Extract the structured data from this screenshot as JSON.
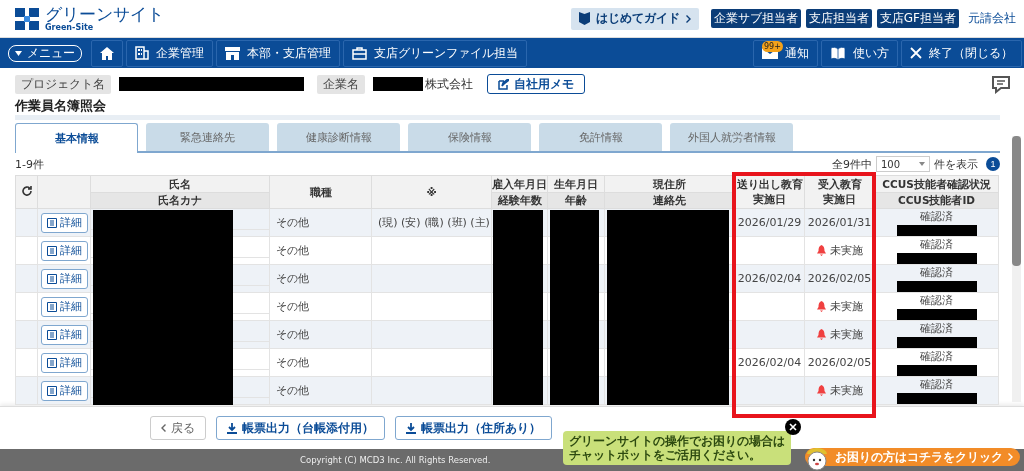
{
  "header": {
    "logo_title": "グリーンサイト",
    "logo_subtitle": "Green-Site",
    "guide_button": "はじめてガイド",
    "roles": [
      "企業サブ担当者",
      "支店担当者",
      "支店GF担当者"
    ],
    "company_type": "元請会社"
  },
  "nav": {
    "menu": "メニュー",
    "items": [
      {
        "label": "企業管理"
      },
      {
        "label": "本部・支店管理"
      },
      {
        "label": "支店グリーンファイル担当"
      }
    ],
    "right": [
      {
        "badge": "99+",
        "label": "通知"
      },
      {
        "label": "使い方"
      },
      {
        "label": "終了（閉じる）"
      }
    ]
  },
  "project": {
    "project_label": "プロジェクト名",
    "company_label": "企業名",
    "company_suffix": "株式会社",
    "memo_button": "自社用メモ"
  },
  "title": "作業員名簿照会",
  "tabs": [
    {
      "label": "基本情報",
      "selected": true
    },
    {
      "label": "緊急連絡先",
      "selected": false
    },
    {
      "label": "健康診断情報",
      "selected": false
    },
    {
      "label": "保険情報",
      "selected": false
    },
    {
      "label": "免許情報",
      "selected": false
    },
    {
      "label": "外国人就労者情報",
      "selected": false
    }
  ],
  "list_info": {
    "range": "1-9件",
    "total": "全9件中",
    "page_size": "100",
    "page_size_suffix": "件を表示",
    "page": "1"
  },
  "table": {
    "columns": [
      {
        "lines": [
          "氏名",
          "氏名カナ"
        ],
        "divided": true
      },
      {
        "lines": [
          "職種"
        ]
      },
      {
        "lines": [
          "※"
        ]
      },
      {
        "lines": [
          "雇入年月日",
          "経験年数"
        ],
        "divided": true
      },
      {
        "lines": [
          "生年月日",
          "年齢"
        ],
        "divided": true
      },
      {
        "lines": [
          "現住所",
          "連絡先"
        ],
        "divided": true
      },
      {
        "lines": [
          "送り出し教育",
          "実施日"
        ],
        "divided": false
      },
      {
        "lines": [
          "受入教育",
          "実施日"
        ],
        "divided": false
      },
      {
        "lines": [
          "CCUS技能者確認状況",
          "CCUS技能者ID"
        ],
        "divided": true
      }
    ],
    "rows": [
      {
        "detail": "詳細",
        "job": "その他",
        "marks": "(現) (安) (職) (班) (主)",
        "sent_date": "2026/01/29",
        "received": {
          "kind": "date",
          "text": "2026/01/31"
        },
        "ccus_status": "確認済"
      },
      {
        "detail": "詳細",
        "job": "その他",
        "received": {
          "kind": "pending",
          "text": "未実施"
        },
        "ccus_status": "確認済"
      },
      {
        "detail": "詳細",
        "job": "その他",
        "sent_date": "2026/02/04",
        "received": {
          "kind": "date",
          "text": "2026/02/05"
        },
        "ccus_status": "確認済"
      },
      {
        "detail": "詳細",
        "job": "その他",
        "received": {
          "kind": "pending",
          "text": "未実施"
        },
        "ccus_status": "確認済"
      },
      {
        "detail": "詳細",
        "job": "その他",
        "received": {
          "kind": "pending",
          "text": "未実施"
        },
        "ccus_status": "確認済"
      },
      {
        "detail": "詳細",
        "job": "その他",
        "sent_date": "2026/02/04",
        "received": {
          "kind": "date",
          "text": "2026/02/05"
        },
        "ccus_status": "確認済"
      },
      {
        "detail": "詳細",
        "job": "その他",
        "received": {
          "kind": "pending",
          "text": "未実施"
        },
        "ccus_status": "確認済"
      }
    ]
  },
  "actions": {
    "back": "戻る",
    "exports": [
      "帳票出力（台帳添付用）",
      "帳票出力（住所あり）"
    ]
  },
  "footer": {
    "copyright": "Copyright (C) MCD3 Inc. All Rights Reserved."
  },
  "chat": {
    "message_lines": [
      "グリーンサイトの操作でお困りの場合は",
      "チャットボットをご活用ください。"
    ],
    "button": "お困りの方はコチラをクリック"
  }
}
